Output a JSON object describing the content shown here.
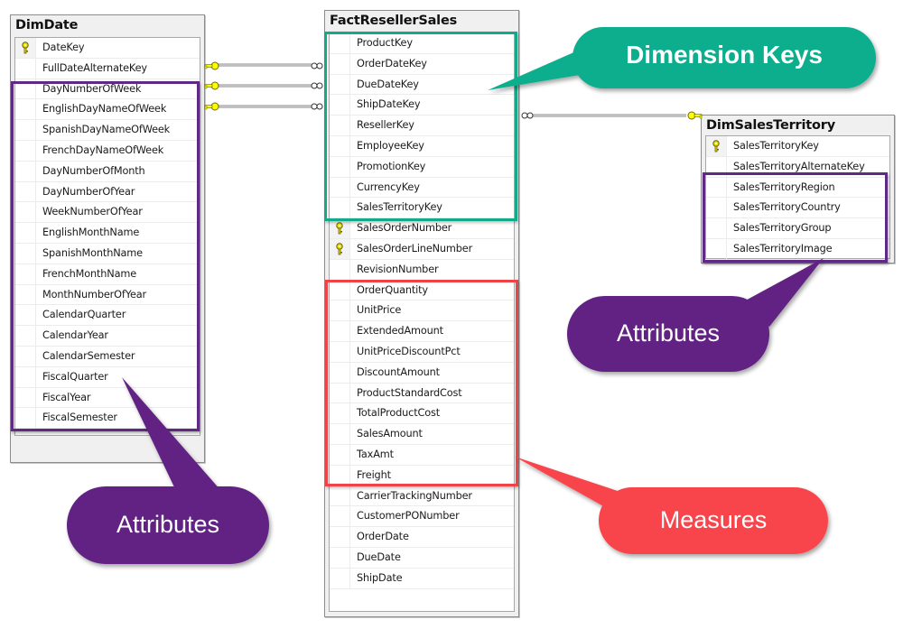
{
  "tables": {
    "dim_date": {
      "title": "DimDate",
      "columns": [
        {
          "name": "DateKey",
          "pk": true
        },
        {
          "name": "FullDateAlternateKey",
          "pk": false
        },
        {
          "name": "DayNumberOfWeek",
          "pk": false
        },
        {
          "name": "EnglishDayNameOfWeek",
          "pk": false
        },
        {
          "name": "SpanishDayNameOfWeek",
          "pk": false
        },
        {
          "name": "FrenchDayNameOfWeek",
          "pk": false
        },
        {
          "name": "DayNumberOfMonth",
          "pk": false
        },
        {
          "name": "DayNumberOfYear",
          "pk": false
        },
        {
          "name": "WeekNumberOfYear",
          "pk": false
        },
        {
          "name": "EnglishMonthName",
          "pk": false
        },
        {
          "name": "SpanishMonthName",
          "pk": false
        },
        {
          "name": "FrenchMonthName",
          "pk": false
        },
        {
          "name": "MonthNumberOfYear",
          "pk": false
        },
        {
          "name": "CalendarQuarter",
          "pk": false
        },
        {
          "name": "CalendarYear",
          "pk": false
        },
        {
          "name": "CalendarSemester",
          "pk": false
        },
        {
          "name": "FiscalQuarter",
          "pk": false
        },
        {
          "name": "FiscalYear",
          "pk": false
        },
        {
          "name": "FiscalSemester",
          "pk": false
        }
      ]
    },
    "fact_reseller_sales": {
      "title": "FactResellerSales",
      "columns": [
        {
          "name": "ProductKey",
          "pk": false
        },
        {
          "name": "OrderDateKey",
          "pk": false
        },
        {
          "name": "DueDateKey",
          "pk": false
        },
        {
          "name": "ShipDateKey",
          "pk": false
        },
        {
          "name": "ResellerKey",
          "pk": false
        },
        {
          "name": "EmployeeKey",
          "pk": false
        },
        {
          "name": "PromotionKey",
          "pk": false
        },
        {
          "name": "CurrencyKey",
          "pk": false
        },
        {
          "name": "SalesTerritoryKey",
          "pk": false
        },
        {
          "name": "SalesOrderNumber",
          "pk": true
        },
        {
          "name": "SalesOrderLineNumber",
          "pk": true
        },
        {
          "name": "RevisionNumber",
          "pk": false
        },
        {
          "name": "OrderQuantity",
          "pk": false
        },
        {
          "name": "UnitPrice",
          "pk": false
        },
        {
          "name": "ExtendedAmount",
          "pk": false
        },
        {
          "name": "UnitPriceDiscountPct",
          "pk": false
        },
        {
          "name": "DiscountAmount",
          "pk": false
        },
        {
          "name": "ProductStandardCost",
          "pk": false
        },
        {
          "name": "TotalProductCost",
          "pk": false
        },
        {
          "name": "SalesAmount",
          "pk": false
        },
        {
          "name": "TaxAmt",
          "pk": false
        },
        {
          "name": "Freight",
          "pk": false
        },
        {
          "name": "CarrierTrackingNumber",
          "pk": false
        },
        {
          "name": "CustomerPONumber",
          "pk": false
        },
        {
          "name": "OrderDate",
          "pk": false
        },
        {
          "name": "DueDate",
          "pk": false
        },
        {
          "name": "ShipDate",
          "pk": false
        }
      ]
    },
    "dim_sales_territory": {
      "title": "DimSalesTerritory",
      "columns": [
        {
          "name": "SalesTerritoryKey",
          "pk": true
        },
        {
          "name": "SalesTerritoryAlternateKey",
          "pk": false
        },
        {
          "name": "SalesTerritoryRegion",
          "pk": false
        },
        {
          "name": "SalesTerritoryCountry",
          "pk": false
        },
        {
          "name": "SalesTerritoryGroup",
          "pk": false
        },
        {
          "name": "SalesTerritoryImage",
          "pk": false
        }
      ]
    }
  },
  "relationships": [
    {
      "from": "DimDate",
      "to": "FactResellerSales",
      "type": "one-to-many"
    },
    {
      "from": "DimDate",
      "to": "FactResellerSales",
      "type": "one-to-many"
    },
    {
      "from": "DimDate",
      "to": "FactResellerSales",
      "type": "one-to-many"
    },
    {
      "from": "DimSalesTerritory",
      "to": "FactResellerSales",
      "type": "one-to-many"
    }
  ],
  "callouts": {
    "dimension_keys": {
      "label": "Dimension Keys",
      "color": "#0aae8e"
    },
    "attributes_territory": {
      "label": "Attributes",
      "color": "#622483"
    },
    "attributes_date": {
      "label": "Attributes",
      "color": "#622483"
    },
    "measures": {
      "label": "Measures",
      "color": "#f8454b"
    }
  },
  "highlight_colors": {
    "attributes": "#5e2a84",
    "dimension_keys": "#14a98a",
    "measures": "#ef4348"
  },
  "icons": {
    "primary_key": "key-icon",
    "relationship_one": "key-endpoint-icon",
    "relationship_many": "infinity-endpoint-icon"
  }
}
